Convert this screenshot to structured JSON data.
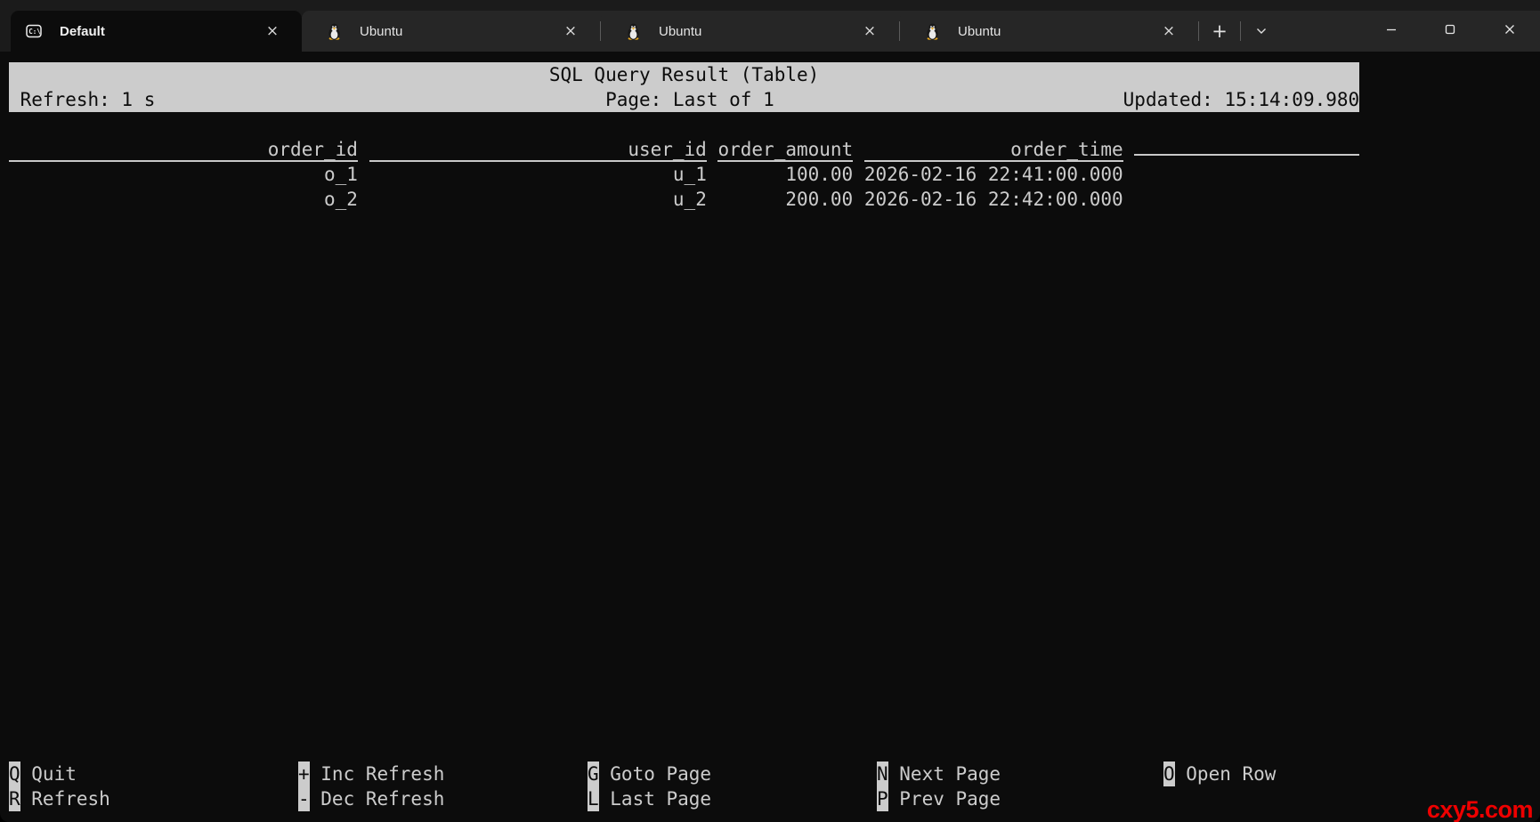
{
  "window": {
    "tabs": [
      {
        "label": "Default",
        "icon": "cmd-icon",
        "active": true
      },
      {
        "label": "Ubuntu",
        "icon": "tux-penguin-icon",
        "active": false
      },
      {
        "label": "Ubuntu",
        "icon": "tux-penguin-icon",
        "active": false
      },
      {
        "label": "Ubuntu",
        "icon": "tux-penguin-icon",
        "active": false
      }
    ],
    "glyphs": {
      "close_tab": "×",
      "new_tab": "+"
    },
    "controls": [
      "minimize",
      "maximize",
      "close"
    ]
  },
  "statusbar": {
    "title": "SQL Query Result (Table)",
    "refresh": "Refresh: 1 s",
    "page": "Page: Last of 1",
    "updated": "Updated: 15:14:09.980"
  },
  "table": {
    "columns": [
      "order_id",
      "user_id",
      "order_amount",
      "order_time"
    ],
    "rows": [
      [
        "o_1",
        "u_1",
        "100.00",
        "2026-02-16 22:41:00.000"
      ],
      [
        "o_2",
        "u_2",
        "200.00",
        "2026-02-16 22:42:00.000"
      ]
    ]
  },
  "help": [
    [
      {
        "key": "Q",
        "label": "Quit"
      },
      {
        "key": "R",
        "label": "Refresh"
      }
    ],
    [
      {
        "key": "+",
        "label": "Inc Refresh"
      },
      {
        "key": "-",
        "label": "Dec Refresh"
      }
    ],
    [
      {
        "key": "G",
        "label": "Goto Page"
      },
      {
        "key": "L",
        "label": "Last Page"
      }
    ],
    [
      {
        "key": "N",
        "label": "Next Page"
      },
      {
        "key": "P",
        "label": "Prev Page"
      }
    ],
    [
      {
        "key": "O",
        "label": "Open Row"
      }
    ]
  ],
  "watermark": "cxy5.com",
  "colors": {
    "terminal_bg": "#0c0c0c",
    "terminal_fg": "#cccccc",
    "statusbar_bg": "#cccccc",
    "statusbar_fg": "#0c0c0c",
    "titlebar_bg": "#1b1b1b",
    "tab_band_bg": "#262626",
    "active_tab_bg": "#0c0c0c",
    "watermark_red": "#ee0000"
  }
}
